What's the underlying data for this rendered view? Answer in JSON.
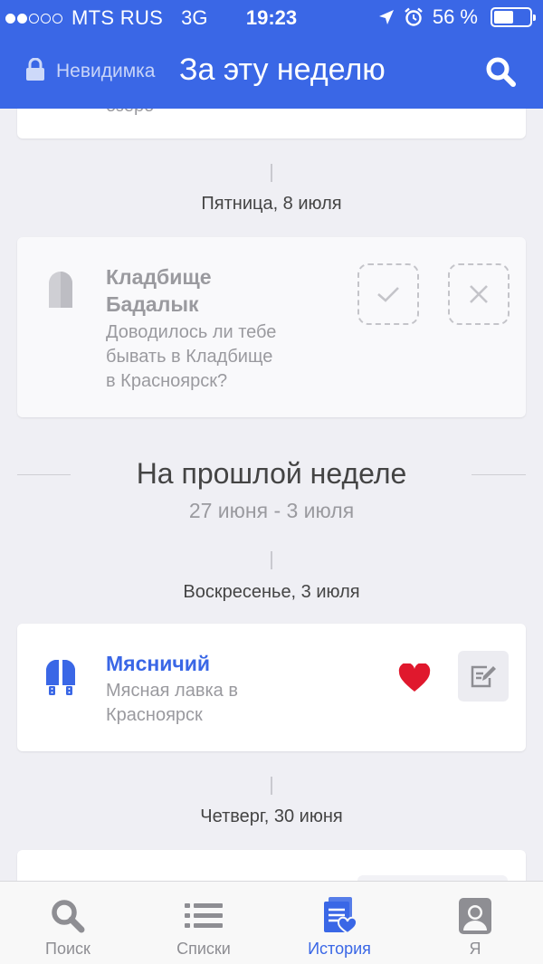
{
  "status_bar": {
    "carrier": "MTS RUS",
    "network": "3G",
    "time": "19:23",
    "battery": "56 %",
    "battery_level": 0.56,
    "signal_bars_filled": 2,
    "signal_bars_total": 5
  },
  "nav": {
    "invisible_label": "Невидимка",
    "title": "За эту неделю",
    "icons": [
      "lock-icon",
      "search-icon"
    ]
  },
  "top_card": {
    "partial_text": "озеро"
  },
  "friday": {
    "day_label": "Пятница, 8 июля",
    "place": {
      "name_line1": "Кладбище",
      "name_line2": "Бадалык",
      "question_line1": "Доводилось ли тебе",
      "question_line2": "бывать в Кладбище",
      "question_line3": "в Красноярск?",
      "icon": "tombstone-icon"
    }
  },
  "last_week": {
    "title": "На прошлой неделе",
    "range": "27 июня - 3 июля"
  },
  "sunday": {
    "day_label": "Воскресенье, 3 июля",
    "place": {
      "name": "Мясничий",
      "desc_line1": "Мясная лавка в",
      "desc_line2": "Красноярск",
      "icon": "butcher-knives-icon",
      "liked": true
    }
  },
  "thursday": {
    "day_label": "Четверг, 30 июня"
  },
  "tabs": [
    {
      "label": "Поиск",
      "icon": "search-icon",
      "active": false
    },
    {
      "label": "Списки",
      "icon": "list-icon",
      "active": false
    },
    {
      "label": "История",
      "icon": "history-icon",
      "active": true
    },
    {
      "label": "Я",
      "icon": "profile-icon",
      "active": false
    }
  ],
  "colors": {
    "brand": "#3a67e6",
    "heart": "#e0182d",
    "background": "#efeff4"
  }
}
